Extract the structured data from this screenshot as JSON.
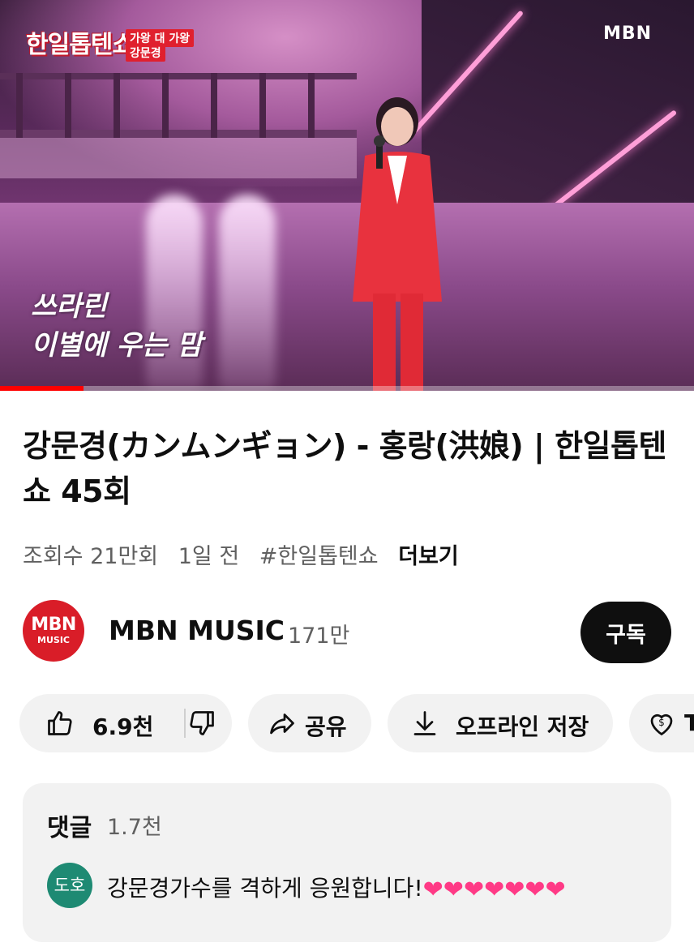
{
  "video": {
    "overlay": {
      "show_logo": "한일톱텐쇼",
      "tag_top": "가왕 대 가왕",
      "tag_name": "강문경",
      "broadcaster": "MBN",
      "lyric_line1": "쓰라린",
      "lyric_line2": "이별에 우는 맘"
    },
    "progress_fraction": 0.12
  },
  "title": "강문경(カンムンギョン) - 홍랑(洪娘) | 한일톱텐쇼 45회",
  "meta": {
    "views": "조회수 21만회",
    "age": "1일 전",
    "hashtag": "#한일톱텐쇼",
    "more": "더보기"
  },
  "channel": {
    "avatar_top": "MBN",
    "avatar_bottom": "MUSIC",
    "name": "MBN MUSIC",
    "subscribers": "171만",
    "subscribe_label": "구독"
  },
  "actions": {
    "likes": "6.9천",
    "share": "공유",
    "download": "오프라인 저장",
    "thanks_partial": "T"
  },
  "comments": {
    "heading": "댓글",
    "count": "1.7천",
    "first": {
      "avatar_text": "도호",
      "text": "강문경가수를 격하게 응원합니다!",
      "hearts": "❤❤❤❤❤❤❤"
    }
  },
  "colors": {
    "accent_red": "#ff0000",
    "subscribe_bg": "#0f0f0f",
    "pill_bg": "#f2f2f2",
    "channel_avatar": "#d91d28",
    "comment_avatar": "#1e8a73",
    "heart": "#ff3a86"
  }
}
